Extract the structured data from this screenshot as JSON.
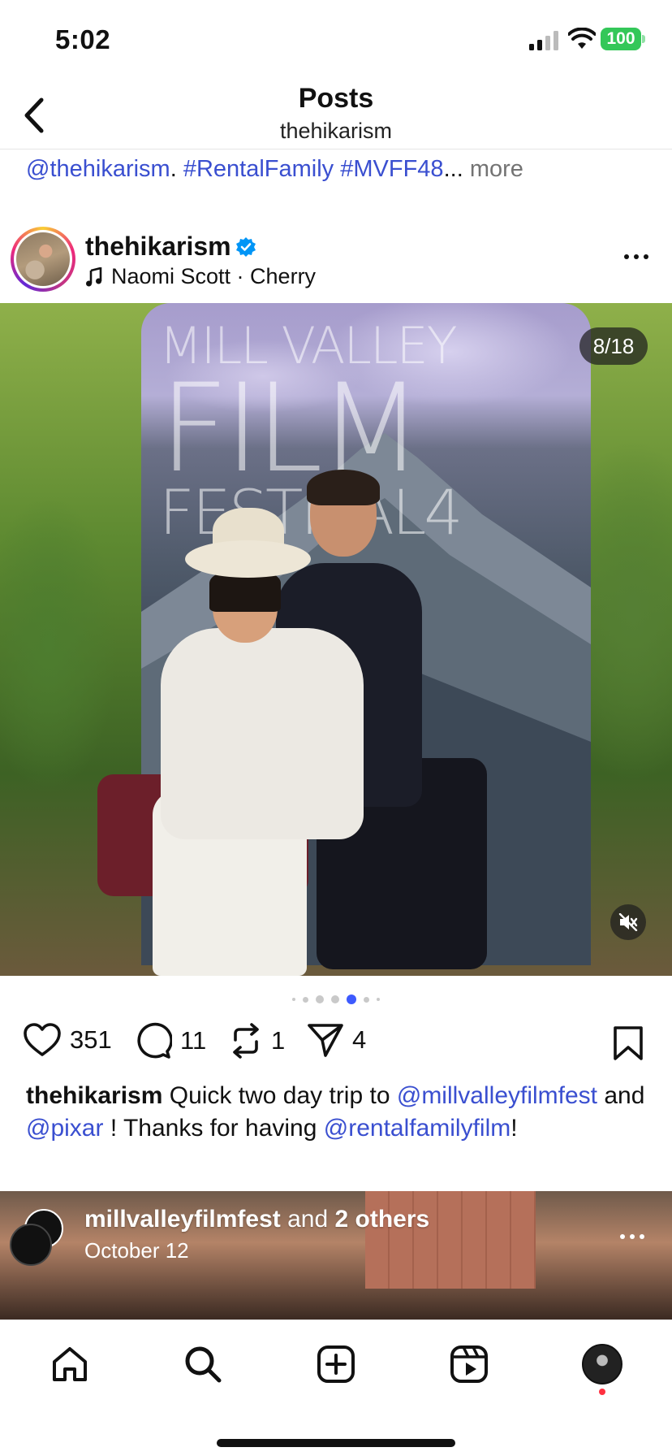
{
  "status_bar": {
    "time": "5:02",
    "battery": "100"
  },
  "header": {
    "title": "Posts",
    "subtitle": "thehikarism"
  },
  "prev_caption": {
    "mention": "@thehikarism",
    "sep": ". ",
    "tag1": "#RentalFamily",
    "tag2": "#MVFF48",
    "ellipsis": "...",
    "more": "more"
  },
  "post": {
    "username": "thehikarism",
    "music": "Naomi Scott · Cherry",
    "counter": "8/18",
    "carousel": {
      "current": 8,
      "total": 18
    },
    "poster_text": {
      "line1": "MILL VALLEY",
      "line2": "FILM",
      "line3": "FESTIVAL4"
    },
    "likes": "351",
    "comments": "11",
    "reposts": "1",
    "shares": "4",
    "caption": {
      "user": "thehikarism",
      "t1": " Quick two day trip to ",
      "m1": "@millvalleyfilmfest",
      "t2": " and ",
      "m2": "@pixar",
      "t3": " ! Thanks for having ",
      "m3": "@rentalfamilyfilm",
      "t4": "!"
    }
  },
  "next_post": {
    "user": "millvalleyfilmfest",
    "and": " and ",
    "others": "2 others",
    "date": "October 12"
  },
  "icons": {
    "back": "chevron-left-icon",
    "verified": "verified-badge-icon",
    "music": "music-note-icon",
    "more": "more-horizontal-icon",
    "mute": "speaker-muted-icon",
    "like": "heart-icon",
    "comment": "comment-icon",
    "repost": "repost-icon",
    "share": "paper-plane-icon",
    "bookmark": "bookmark-icon",
    "home": "home-icon",
    "search": "search-icon",
    "create": "plus-square-icon",
    "reels": "reels-icon"
  },
  "colors": {
    "link": "#3a4fd0",
    "verified": "#0095f6",
    "battery": "#34c759",
    "notification": "#ff3040"
  }
}
